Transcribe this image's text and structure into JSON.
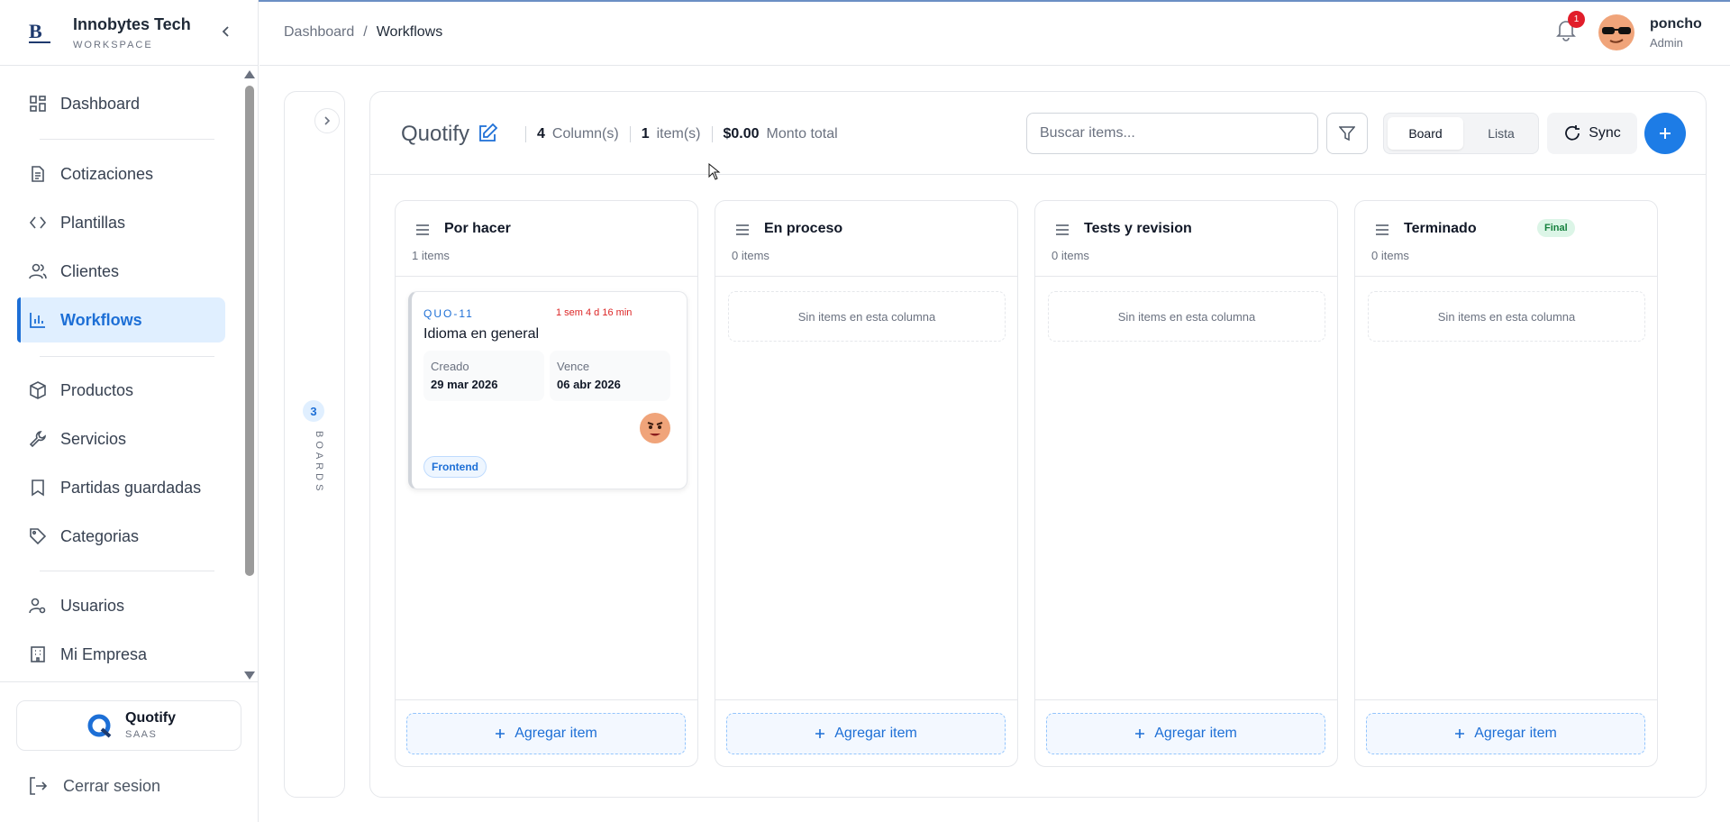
{
  "sidebar": {
    "brand_name": "Innobytes Tech",
    "brand_sub": "WORKSPACE",
    "items": [
      {
        "label": "Dashboard",
        "icon": "grid-icon"
      },
      {
        "label": "Cotizaciones",
        "icon": "document-icon"
      },
      {
        "label": "Plantillas",
        "icon": "code-icon"
      },
      {
        "label": "Clientes",
        "icon": "users-icon"
      },
      {
        "label": "Workflows",
        "icon": "bar-chart-icon",
        "active": true
      },
      {
        "label": "Productos",
        "icon": "box-icon"
      },
      {
        "label": "Servicios",
        "icon": "wrench-icon"
      },
      {
        "label": "Partidas guardadas",
        "icon": "bookmark-icon"
      },
      {
        "label": "Categorias",
        "icon": "tag-icon"
      },
      {
        "label": "Usuarios",
        "icon": "user-settings-icon"
      },
      {
        "label": "Mi Empresa",
        "icon": "building-icon"
      }
    ],
    "company": {
      "name": "Quotify",
      "plan": "SAAS"
    },
    "logout_label": "Cerrar sesion"
  },
  "header": {
    "breadcrumb": {
      "root": "Dashboard",
      "separator": "/",
      "current": "Workflows"
    },
    "notifications_count": "1",
    "user": {
      "name": "poncho",
      "role": "Admin"
    }
  },
  "rail": {
    "count": "3",
    "label": "BOARDS"
  },
  "board": {
    "title": "Quotify",
    "columns_count": "4",
    "columns_label": "Column(s)",
    "items_count": "1",
    "items_label": "item(s)",
    "total": "$0.00",
    "total_label": "Monto total",
    "search_placeholder": "Buscar items...",
    "view_board": "Board",
    "view_list": "Lista",
    "sync_label": "Sync"
  },
  "columns": [
    {
      "title": "Por hacer",
      "count": "1 items",
      "add_label": "Agregar item",
      "card": {
        "code": "QUO-11",
        "time": "1 sem 4 d 16 min",
        "title": "Idioma en general",
        "created_label": "Creado",
        "created": "29 mar 2026",
        "due_label": "Vence",
        "due": "06 abr 2026",
        "tag": "Frontend"
      }
    },
    {
      "title": "En proceso",
      "count": "0 items",
      "empty": "Sin items en esta columna",
      "add_label": "Agregar item"
    },
    {
      "title": "Tests y revision",
      "count": "0 items",
      "empty": "Sin items en esta columna",
      "add_label": "Agregar item"
    },
    {
      "title": "Terminado",
      "count": "0 items",
      "badge": "Final",
      "empty": "Sin items en esta columna",
      "add_label": "Agregar item"
    }
  ],
  "colors": {
    "accent": "#1d7ce6",
    "active_bg": "#e0efff",
    "danger": "#dc2626",
    "success_bg": "#dcf5e7"
  }
}
